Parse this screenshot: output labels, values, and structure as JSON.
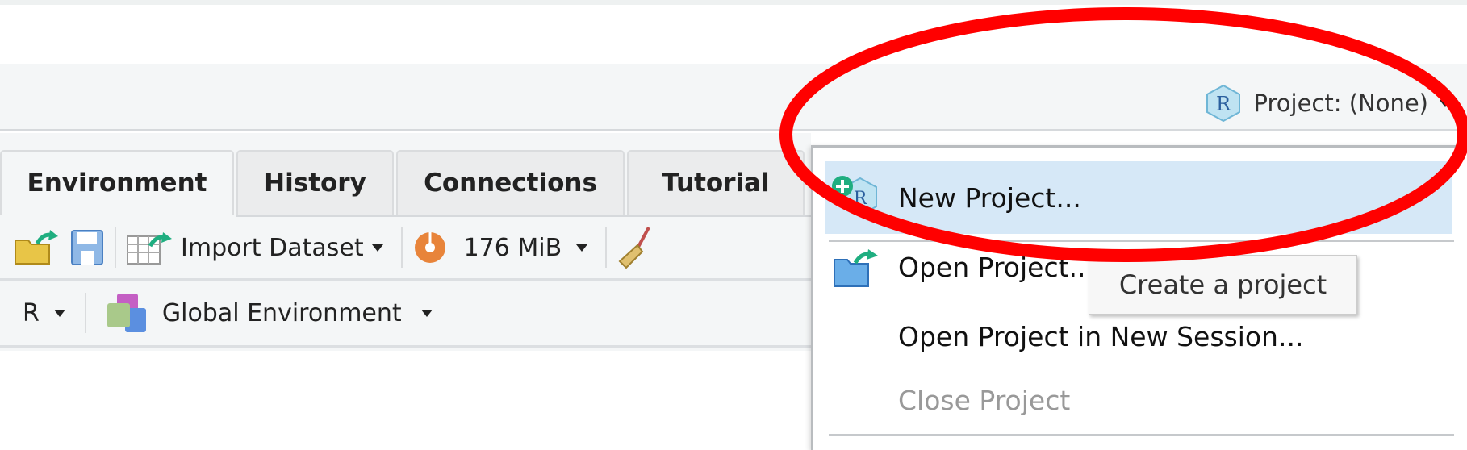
{
  "toolbar": {
    "project_label": "Project: (None)",
    "project_icon": "r-project-icon"
  },
  "tabs": [
    {
      "label": "Environment",
      "active": true
    },
    {
      "label": "History"
    },
    {
      "label": "Connections"
    },
    {
      "label": "Tutorial"
    }
  ],
  "env_toolbar": {
    "import_dataset": "Import Dataset",
    "memory": "176 MiB",
    "language": "R",
    "environment": "Global Environment"
  },
  "project_menu": {
    "items": [
      {
        "label": "New Project...",
        "highlighted": true,
        "icon": "new-project-icon"
      },
      {
        "label": "Open Project...",
        "icon": "open-folder-icon"
      },
      {
        "label": "Open Project in New Session..."
      },
      {
        "label": "Close Project",
        "disabled": true
      }
    ]
  },
  "tooltip": {
    "text": "Create a project"
  },
  "colors": {
    "highlight": "#d6e8f7",
    "annotation": "#ff0000",
    "accent_green": "#1fae80"
  }
}
